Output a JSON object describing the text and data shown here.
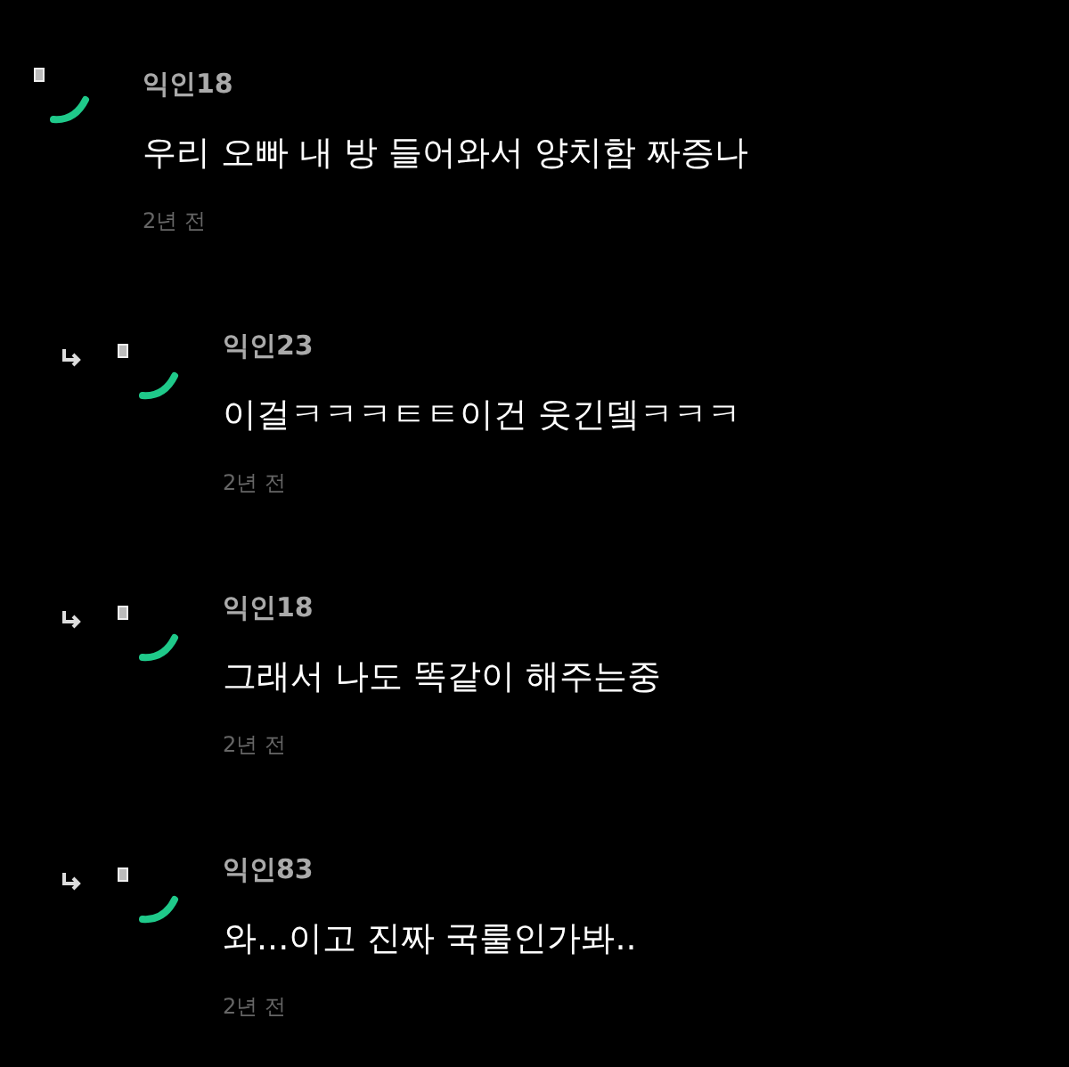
{
  "comment": {
    "author": "익인18",
    "text": "우리 오빠 내 방 들어와서 양치함 짜증나",
    "time": "2년 전"
  },
  "replies": [
    {
      "author": "익인23",
      "text": "이걸ㅋㅋㅋㅌㅌ이건 웃긴뎈ㅋㅋㅋ",
      "time": "2년 전"
    },
    {
      "author": "익인18",
      "text": "그래서 나도 똑같이 해주는중",
      "time": "2년 전"
    },
    {
      "author": "익인83",
      "text": "와...이고 진짜 국룰인가봐..",
      "time": "2년 전"
    }
  ]
}
